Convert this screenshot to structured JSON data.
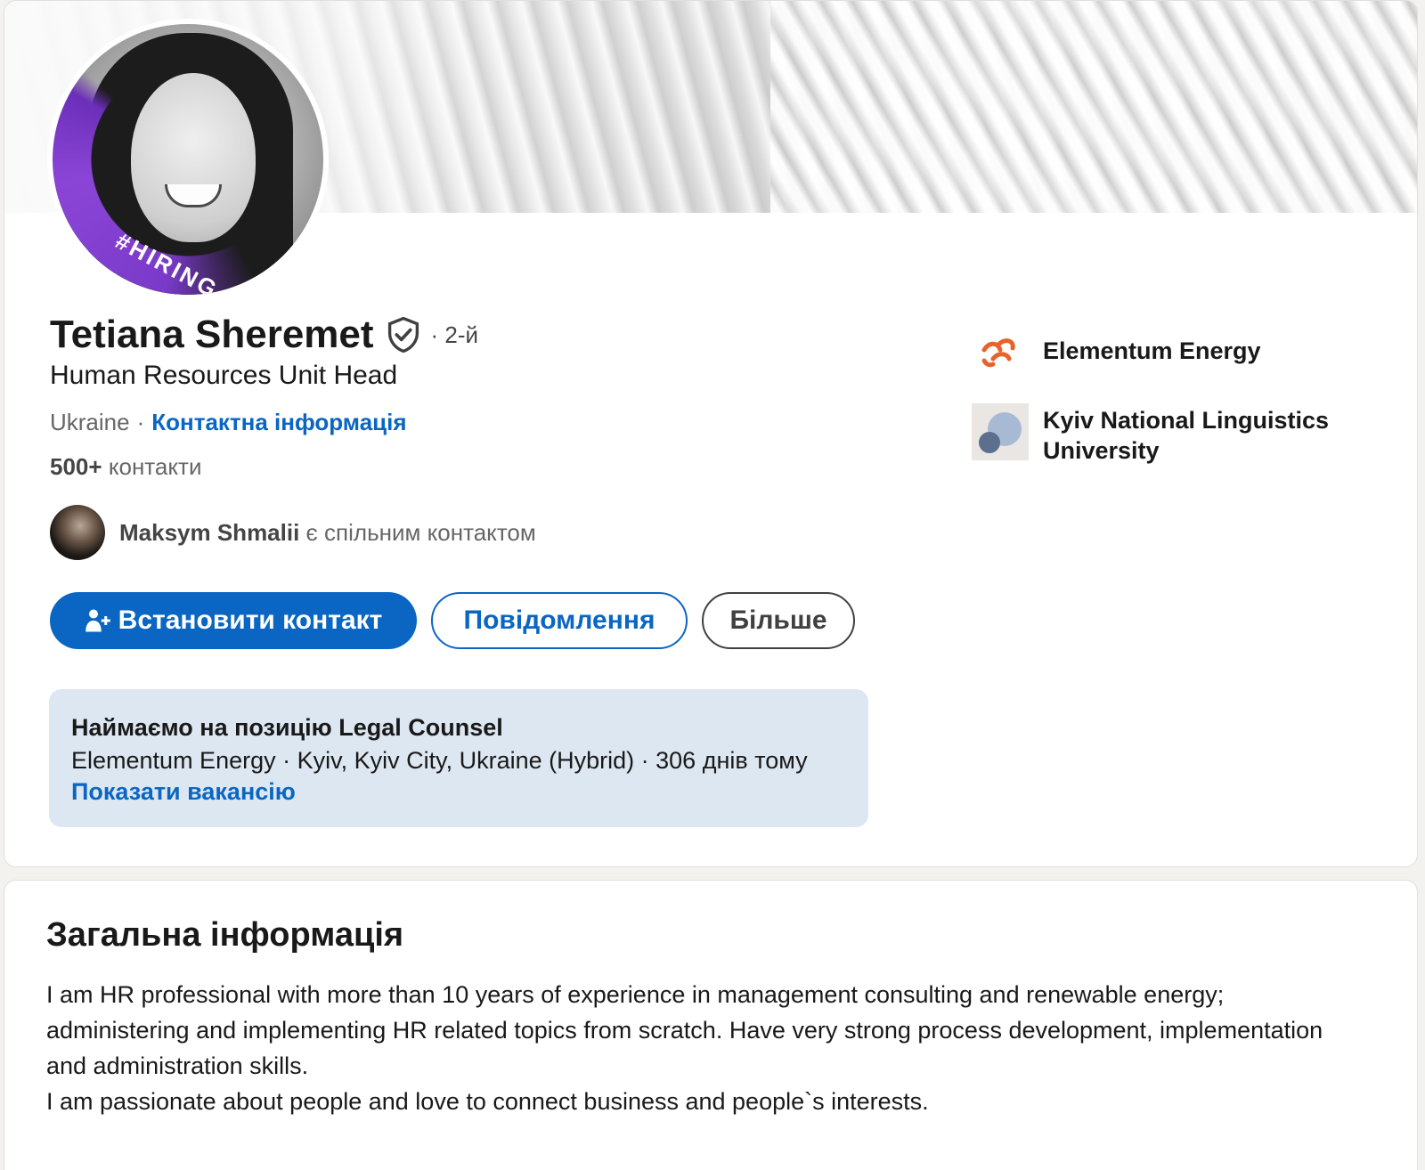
{
  "profile": {
    "hiring_badge": "#HIRING",
    "name": "Tetiana Sheremet",
    "degree": "· 2-й",
    "headline": "Human Resources Unit Head",
    "location": "Ukraine",
    "separator": "·",
    "contact_info_link": "Контактна інформація",
    "connections_count": "500+",
    "connections_label": "контакти"
  },
  "mutual": {
    "name": "Maksym Shmalii",
    "suffix": "є спільним контактом"
  },
  "actions": {
    "connect": "Встановити контакт",
    "message": "Повідомлення",
    "more": "Більше"
  },
  "job": {
    "title": "Наймаємо на позицію Legal Counsel",
    "meta": "Elementum Energy · Kyiv, Kyiv City, Ukraine (Hybrid) · 306 днів тому",
    "link": "Показати вакансію"
  },
  "orgs": [
    {
      "name": "Elementum Energy",
      "logo_color": "#e8632b"
    },
    {
      "name": "Kyiv National Linguistics University"
    }
  ],
  "about": {
    "title": "Загальна інформація",
    "lines": [
      "I am HR professional with more than 10 years of experience in management consulting and renewable energy; administering and implementing HR related topics from scratch. Have very strong process development, implementation and administration skills.",
      "I am passionate about people and love to connect business and people`s interests."
    ]
  },
  "colors": {
    "accent": "#0a66c2",
    "hiring_ring": "#7a3ac9",
    "job_box_bg": "#dde7f1"
  }
}
